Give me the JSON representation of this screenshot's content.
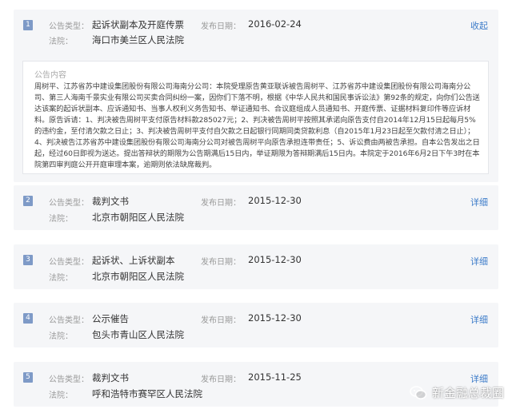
{
  "cards": [
    {
      "num": "1",
      "type_label": "公告类型：",
      "type": "起诉状副本及开庭传票",
      "date_label": "发布日期：",
      "date": "2016-02-24",
      "court_label": "法院：",
      "court": "海口市美兰区人民法院",
      "action": "收起",
      "content_title": "公告内容",
      "content": "周树平、江苏省苏中建设集团股份有限公司海南分公司：本院受理原告黄亚联诉被告周树平、江苏省苏中建设集团股份有限公司海南分公司、第三人海南千景实业有限公司买卖合同纠纷一案，因你们下落不明，根据《中华人民共和国民事诉讼法》第92条的规定，向你们公告送达该案的起诉状副本、应诉通知书、当事人权利义务告知书、举证通知书、合议庭组成人员通知书、开庭传票、证据材料复印件等应诉材料。原告诉请：1、判决被告周树平支付原告材料款285027元；2、判决被告周树平按照其承诺向原告支付自2014年12月15日起每月5%的违约金，至付清欠款之日止；3、判决被告周树平支付自欠款之日起银行同期同类贷款利息（自2015年1月23日起至欠款付清之日止）；4、判决被告江苏省苏中建设集团股份有限公司海南分公司对被告周树平向原告承担连带责任；5、诉讼费由两被告承担。自本公告发出之日起，经过60日即视为送达。提出答辩状的期限为公告期满后15日内，举证期限为答辩期满后15日内。本院定于2016年6月2日下午3时在本院第四审判庭公开开庭审理本案，逾期则依法缺席裁判。"
    },
    {
      "num": "2",
      "type_label": "公告类型：",
      "type": "裁判文书",
      "date_label": "发布日期：",
      "date": "2015-12-30",
      "court_label": "法院：",
      "court": "北京市朝阳区人民法院",
      "action": "详细"
    },
    {
      "num": "3",
      "type_label": "公告类型：",
      "type": "起诉状、上诉状副本",
      "date_label": "发布日期：",
      "date": "2015-12-30",
      "court_label": "法院：",
      "court": "北京市朝阳区人民法院",
      "action": "详细"
    },
    {
      "num": "4",
      "type_label": "公告类型：",
      "type": "公示催告",
      "date_label": "发布日期：",
      "date": "2015-12-30",
      "court_label": "法院：",
      "court": "包头市青山区人民法院",
      "action": "详细"
    },
    {
      "num": "5",
      "type_label": "公告类型：",
      "type": "裁判文书",
      "date_label": "发布日期：",
      "date": "2015-11-25",
      "court_label": "法院：",
      "court": "呼和浩特市赛罕区人民法院",
      "action": "详细"
    }
  ],
  "watermark": {
    "text": "新金融总裁圈",
    "icon": "wechat-icon"
  },
  "colors": {
    "card_bg": "#f5f6f8",
    "badge": "#7e9ac7",
    "link": "#3d7cc9"
  }
}
